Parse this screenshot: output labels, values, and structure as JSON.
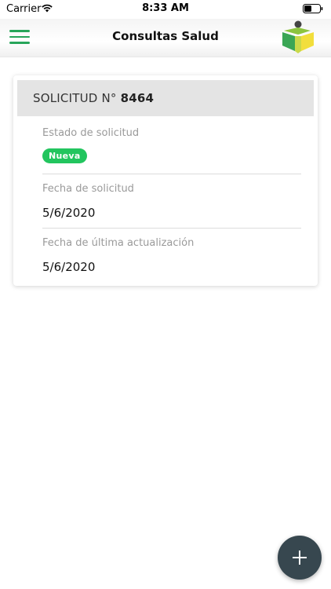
{
  "status_bar": {
    "carrier": "Carrier",
    "time": "8:33 AM"
  },
  "header": {
    "title": "Consultas Salud",
    "menu_icon": "hamburger-menu-icon",
    "logo_icon": "brand-logo-icon"
  },
  "card": {
    "title_prefix": "SOLICITUD N°",
    "request_number": "8464",
    "fields": [
      {
        "label": "Estado de solicitud",
        "badge": "Nueva"
      },
      {
        "label": "Fecha de solicitud",
        "value": "5/6/2020"
      },
      {
        "label": "Fecha de última actualización",
        "value": "5/6/2020"
      }
    ]
  },
  "fab": {
    "icon": "plus-icon"
  },
  "colors": {
    "accent_green": "#27a55a",
    "badge_green": "#22c55e",
    "fab_dark": "#37474f",
    "card_header_gray": "#e4e4e4"
  }
}
